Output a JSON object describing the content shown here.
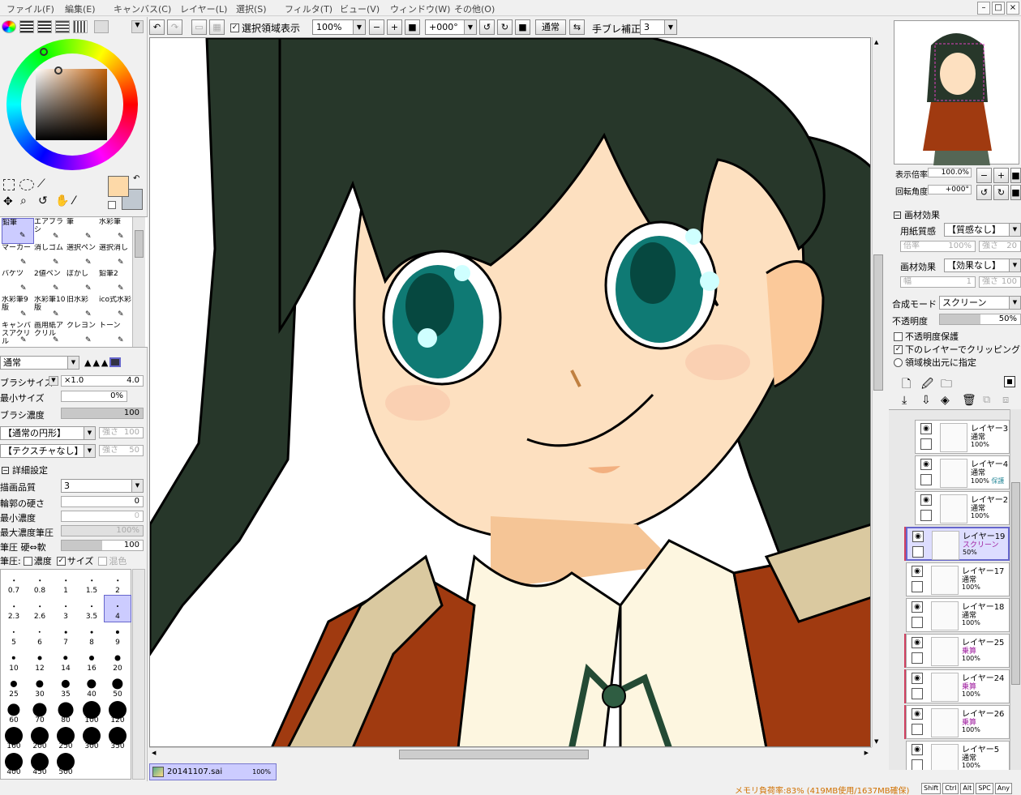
{
  "menubar": {
    "items": [
      "ファイル(F)",
      "編集(E)",
      "キャンバス(C)",
      "レイヤー(L)",
      "選択(S)",
      "フィルタ(T)",
      "ビュー(V)",
      "ウィンドウ(W)",
      "その他(O)"
    ]
  },
  "toolbar": {
    "selection_display_label": "選択領域表示",
    "zoom": "100%",
    "angle": "+000°",
    "mode": "通常",
    "stabilizer_label": "手ブレ補正",
    "stabilizer": "3"
  },
  "colors": {
    "primary": "#fdd9a8",
    "secondary": "#c0c8d0",
    "hair": "#2a3a2a",
    "jacket": "#a03a10"
  },
  "tools": {
    "items": [
      {
        "name": "鉛筆"
      },
      {
        "name": "エアブラシ"
      },
      {
        "name": "筆"
      },
      {
        "name": "水彩筆"
      },
      {
        "name": "マーカー"
      },
      {
        "name": "消しゴム"
      },
      {
        "name": "選択ペン"
      },
      {
        "name": "選択消し"
      },
      {
        "name": "バケツ"
      },
      {
        "name": "2値ペン"
      },
      {
        "name": "ぼかし"
      },
      {
        "name": "鉛筆2"
      },
      {
        "name": "水彩筆9版"
      },
      {
        "name": "水彩筆10版"
      },
      {
        "name": "旧水彩"
      },
      {
        "name": "ico式水彩"
      },
      {
        "name": "キャンバスアクリル"
      },
      {
        "name": "画用紙アクリル"
      },
      {
        "name": "クレヨン"
      },
      {
        "name": "トーン"
      }
    ]
  },
  "brush": {
    "blend_mode": "通常",
    "size_label": "ブラシサイズ",
    "size_mult": "×1.0",
    "size_value": "4.0",
    "min_size_label": "最小サイズ",
    "min_size_value": "0%",
    "density_label": "ブラシ濃度",
    "density_value": "100",
    "shape": "【通常の円形】",
    "shape_strength_label": "強さ",
    "shape_strength": "100",
    "texture": "【テクスチャなし】",
    "texture_strength_label": "強さ",
    "texture_strength": "50"
  },
  "details": {
    "title": "詳細設定",
    "quality_label": "描画品質",
    "quality_value": "3",
    "edge_label": "輪郭の硬さ",
    "edge_value": "0",
    "min_density_label": "最小濃度",
    "min_density_value": "0",
    "max_density_label": "最大濃度筆圧",
    "max_density_value": "100%",
    "pressure_label": "筆圧 硬⇔軟",
    "pressure_value": "100",
    "pressure_opts_label": "筆圧:",
    "opt_density": "濃度",
    "opt_size": "サイズ",
    "opt_blend": "混色"
  },
  "brush_sizes": [
    [
      "0.7",
      "0.8",
      "1",
      "1.5",
      "2"
    ],
    [
      "2.3",
      "2.6",
      "3",
      "3.5",
      "4"
    ],
    [
      "5",
      "6",
      "7",
      "8",
      "9"
    ],
    [
      "10",
      "12",
      "14",
      "16",
      "20"
    ],
    [
      "25",
      "30",
      "35",
      "40",
      "50"
    ],
    [
      "60",
      "70",
      "80",
      "100",
      "120"
    ],
    [
      "160",
      "200",
      "250",
      "300",
      "350"
    ],
    [
      "400",
      "450",
      "500"
    ]
  ],
  "file_tab": {
    "name": "20141107.sai",
    "zoom": "100%"
  },
  "navigator": {
    "zoom_label": "表示倍率",
    "zoom_value": "100.0%",
    "angle_label": "回転角度",
    "angle_value": "+000°"
  },
  "material": {
    "title": "画材効果",
    "paper_label": "用紙質感",
    "paper_value": "【質感なし】",
    "scale_label": "倍率",
    "scale_value": "100%",
    "paper_strength_label": "強さ",
    "paper_strength": "20",
    "effect_label": "画材効果",
    "effect_value": "【効果なし】",
    "width_label": "幅",
    "width_value": "1",
    "effect_strength_label": "強さ",
    "effect_strength": "100"
  },
  "layer_props": {
    "blend_label": "合成モード",
    "blend_value": "スクリーン",
    "opacity_label": "不透明度",
    "opacity_value": "50%",
    "protect_label": "不透明度保護",
    "clip_label": "下のレイヤーでクリッピング",
    "detect_label": "領域検出元に指定"
  },
  "layers": [
    {
      "name": "レイヤー3",
      "mode": "通常",
      "opacity": "100%",
      "extra": "",
      "red": false,
      "active": false,
      "indent": true
    },
    {
      "name": "レイヤー4",
      "mode": "通常",
      "opacity": "100%",
      "extra": "保護",
      "red": false,
      "active": false,
      "indent": true
    },
    {
      "name": "レイヤー2",
      "mode": "通常",
      "opacity": "100%",
      "extra": "",
      "red": false,
      "active": false,
      "indent": true
    },
    {
      "name": "レイヤー19",
      "mode": "スクリーン",
      "opacity": "50%",
      "extra": "",
      "red": true,
      "active": true,
      "indent": false
    },
    {
      "name": "レイヤー17",
      "mode": "通常",
      "opacity": "100%",
      "extra": "",
      "red": false,
      "active": false,
      "indent": false
    },
    {
      "name": "レイヤー18",
      "mode": "通常",
      "opacity": "100%",
      "extra": "",
      "red": false,
      "active": false,
      "indent": false
    },
    {
      "name": "レイヤー25",
      "mode": "乗算",
      "opacity": "100%",
      "extra": "",
      "red": true,
      "active": false,
      "indent": false
    },
    {
      "name": "レイヤー24",
      "mode": "乗算",
      "opacity": "100%",
      "extra": "",
      "red": true,
      "active": false,
      "indent": false
    },
    {
      "name": "レイヤー26",
      "mode": "乗算",
      "opacity": "100%",
      "extra": "",
      "red": true,
      "active": false,
      "indent": false
    },
    {
      "name": "レイヤー5",
      "mode": "通常",
      "opacity": "100%",
      "extra": "",
      "red": false,
      "active": false,
      "indent": false
    }
  ],
  "status": {
    "memory": "メモリ負荷率:83% (419MB使用/1637MB確保)",
    "keys": [
      "Shift",
      "Ctrl",
      "Alt",
      "SPC",
      "Any"
    ]
  }
}
